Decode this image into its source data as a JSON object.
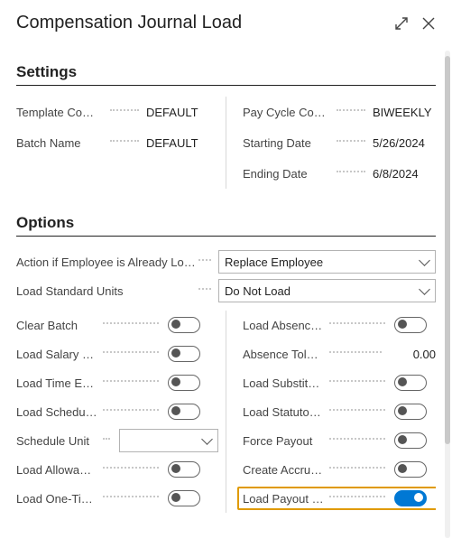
{
  "title": "Compensation Journal Load",
  "sections": {
    "settings": "Settings",
    "options": "Options"
  },
  "settings": {
    "left": [
      {
        "label": "Template Co…",
        "value": "DEFAULT"
      },
      {
        "label": "Batch Name",
        "value": "DEFAULT"
      }
    ],
    "right": [
      {
        "label": "Pay Cycle Co…",
        "value": "BIWEEKLY"
      },
      {
        "label": "Starting Date",
        "value": "5/26/2024"
      },
      {
        "label": "Ending Date",
        "value": "6/8/2024"
      }
    ]
  },
  "options": {
    "action_label": "Action if Employee is Already Lo…",
    "action_value": "Replace Employee",
    "std_units_label": "Load Standard Units",
    "std_units_value": "Do Not Load",
    "left_toggles": [
      {
        "label": "Clear Batch",
        "type": "toggle",
        "state": "off",
        "name": "clear-batch-toggle"
      },
      {
        "label": "Load Salary L…",
        "type": "toggle",
        "state": "off",
        "name": "load-salary-toggle"
      },
      {
        "label": "Load Time E…",
        "type": "toggle",
        "state": "off",
        "name": "load-time-toggle"
      },
      {
        "label": "Load Schedu…",
        "type": "toggle",
        "state": "off",
        "name": "load-schedule-toggle"
      },
      {
        "label": "Schedule Unit",
        "type": "combo",
        "value": "",
        "name": "schedule-unit-combo"
      },
      {
        "label": "Load Allowa…",
        "type": "toggle",
        "state": "off",
        "name": "load-allowance-toggle"
      },
      {
        "label": "Load One-Ti…",
        "type": "toggle",
        "state": "off",
        "name": "load-onetime-toggle"
      }
    ],
    "right_toggles": [
      {
        "label": "Load Absenc…",
        "type": "toggle",
        "state": "off",
        "name": "load-absence-toggle"
      },
      {
        "label": "Absence Tol…",
        "type": "number",
        "value": "0.00",
        "name": "absence-tolerance-value"
      },
      {
        "label": "Load Substit…",
        "type": "toggle",
        "state": "off",
        "name": "load-substitute-toggle"
      },
      {
        "label": "Load Statuto…",
        "type": "toggle",
        "state": "off",
        "name": "load-statutory-toggle"
      },
      {
        "label": "Force Payout",
        "type": "toggle",
        "state": "off",
        "name": "force-payout-toggle"
      },
      {
        "label": "Create Accru…",
        "type": "toggle",
        "state": "off",
        "name": "create-accrual-toggle"
      },
      {
        "label": "Load Payout …",
        "type": "toggle",
        "state": "on",
        "name": "load-payout-toggle",
        "highlight": true
      }
    ]
  }
}
